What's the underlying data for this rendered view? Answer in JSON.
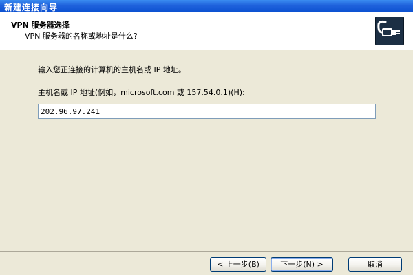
{
  "window": {
    "title": "新建连接向导"
  },
  "header": {
    "title": "VPN 服务器选择",
    "subtitle": "VPN 服务器的名称或地址是什么?",
    "icon": "vpn-connection-icon"
  },
  "main": {
    "prompt": "输入您正连接的计算机的主机名或 IP 地址。",
    "host_label": "主机名或 IP 地址(例如，microsoft.com 或 157.54.0.1)(H):",
    "host_value": "202.96.97.241"
  },
  "buttons": {
    "back_label": "< 上一步(B)",
    "next_label": "下一步(N) >",
    "cancel_label": "取消"
  },
  "colors": {
    "titlebar": "#0a4fd0",
    "dialog_background": "#ece9d8",
    "header_background": "#ffffff",
    "button_border": "#003c74",
    "input_border": "#7f9db9"
  }
}
